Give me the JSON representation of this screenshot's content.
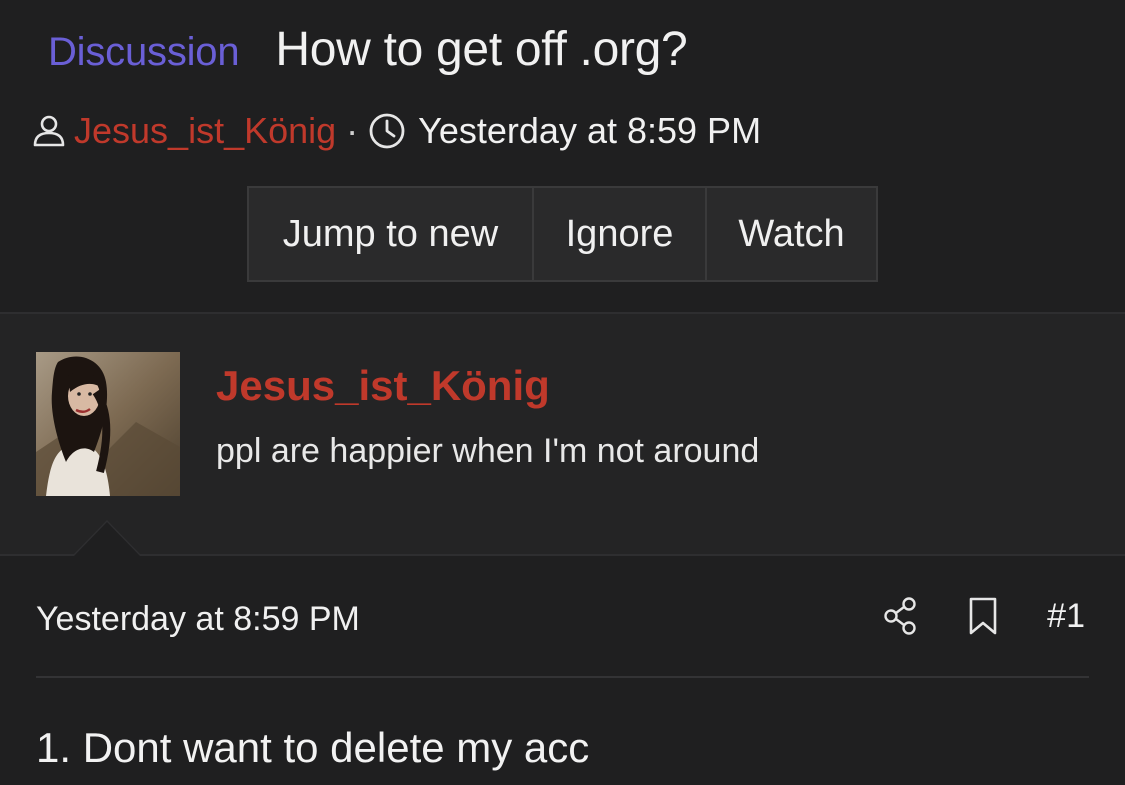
{
  "thread": {
    "prefix": "Discussion",
    "title": "How to get off .org?",
    "author": "Jesus_ist_König",
    "separator": "·",
    "time": "Yesterday at 8:59 PM",
    "icons": {
      "author": "user-icon",
      "time": "clock-icon"
    }
  },
  "actions": {
    "jump_label": "Jump to new",
    "ignore_label": "Ignore",
    "watch_label": "Watch"
  },
  "member": {
    "name": "Jesus_ist_König",
    "title": "ppl are happier when I'm not around",
    "avatar": "avatar-photo"
  },
  "post": {
    "date": "Yesterday at 8:59 PM",
    "number": "#1",
    "body": "1. Dont want to delete my acc",
    "icons": {
      "share": "share-icon",
      "bookmark": "bookmark-icon"
    }
  },
  "colors": {
    "background": "#1f1f20",
    "prefix": "#6a5fd6",
    "username": "#c0392b",
    "text": "#f0f0f0"
  }
}
